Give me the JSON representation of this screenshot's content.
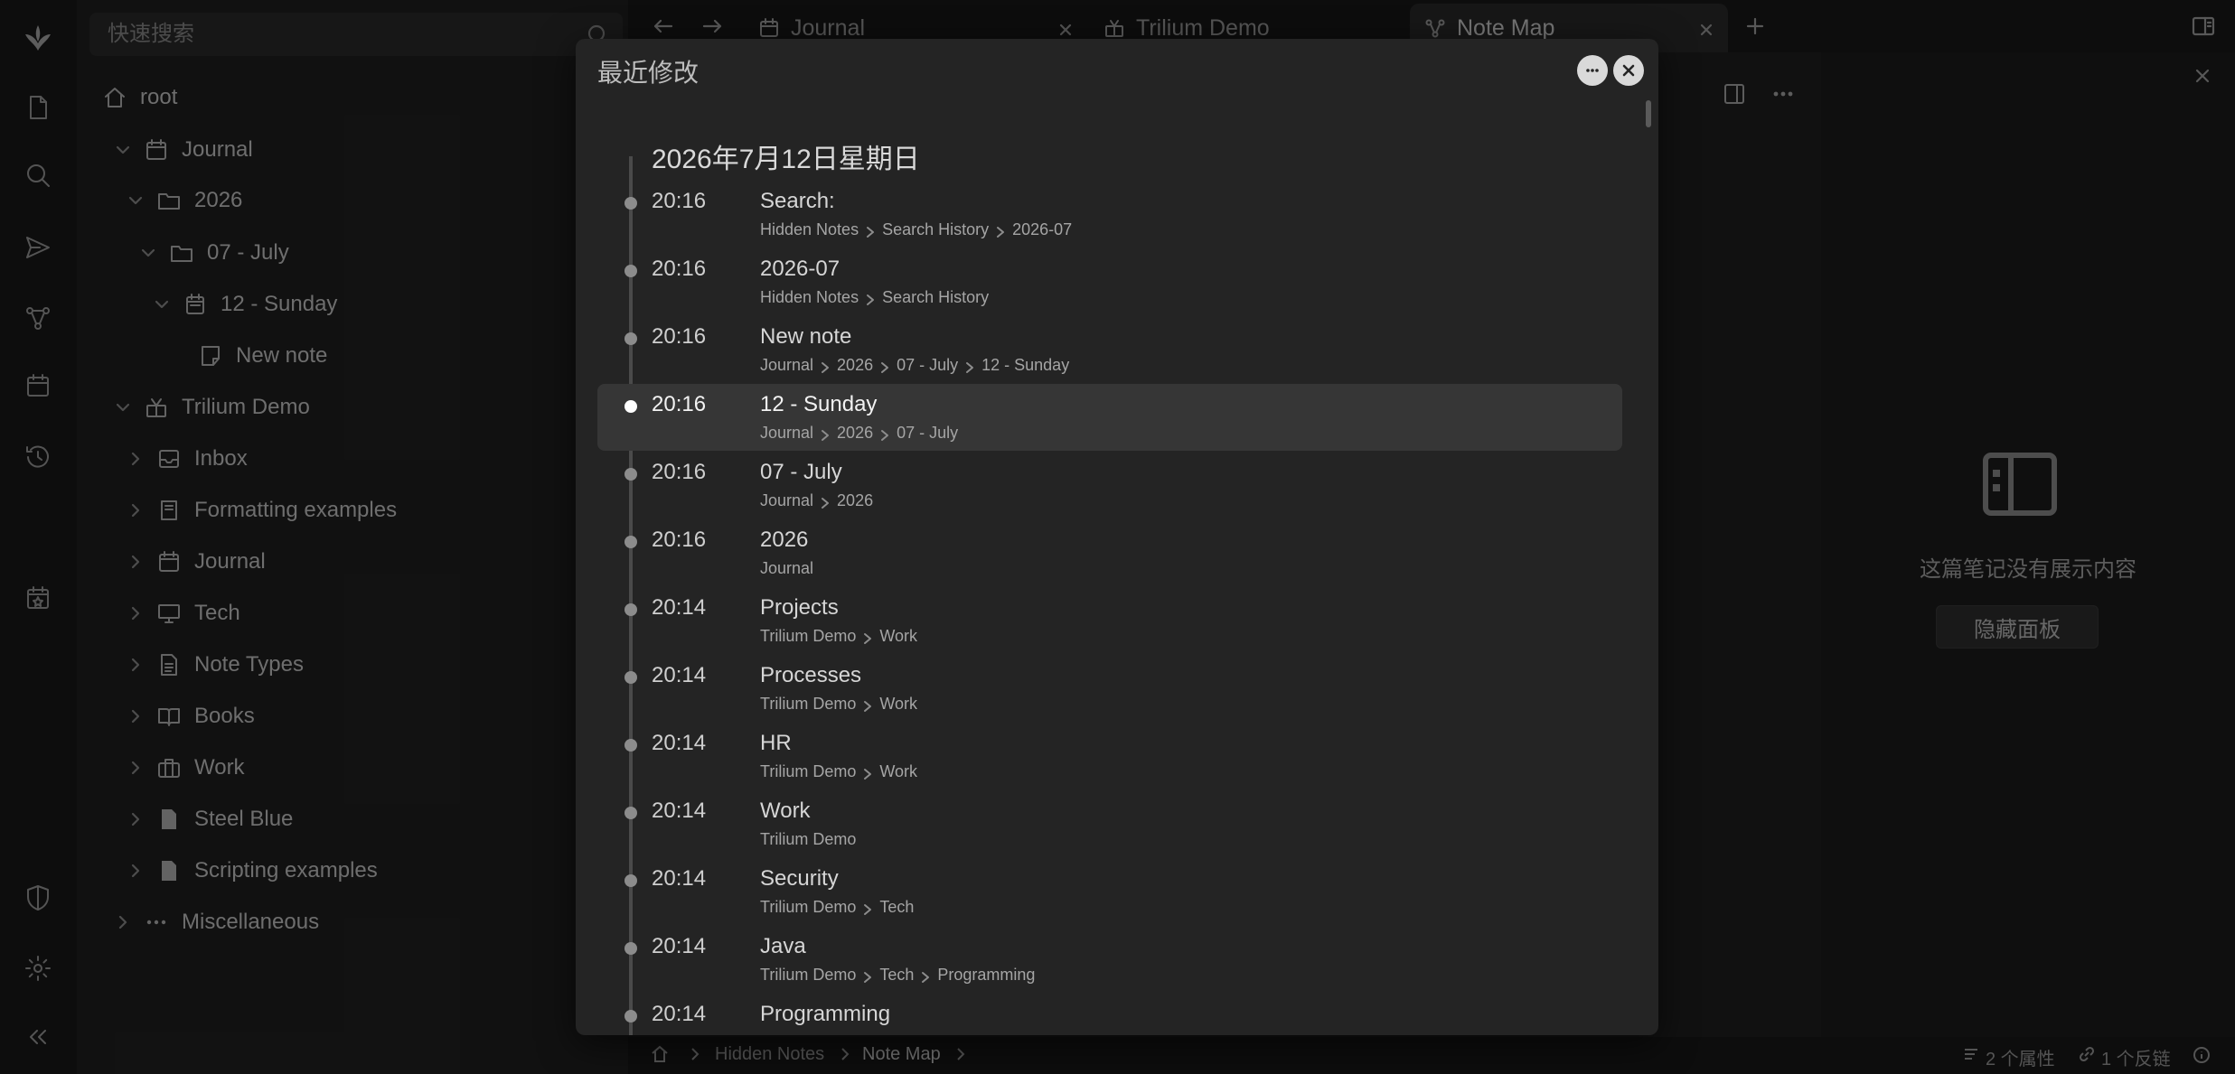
{
  "search": {
    "placeholder": "快速搜索"
  },
  "tree": {
    "items": [
      {
        "label": "root",
        "icon": "home-icon"
      },
      {
        "label": "Journal",
        "icon": "calendar-icon"
      },
      {
        "label": "2026",
        "icon": "folder-icon"
      },
      {
        "label": "07 - July",
        "icon": "folder-icon"
      },
      {
        "label": "12 - Sunday",
        "icon": "calendar-day-icon"
      },
      {
        "label": "New note",
        "icon": "note-icon"
      },
      {
        "label": "Trilium Demo",
        "icon": "demo-icon"
      },
      {
        "label": "Inbox",
        "icon": "inbox-icon"
      },
      {
        "label": "Formatting examples",
        "icon": "book-icon"
      },
      {
        "label": "Journal",
        "icon": "calendar-icon"
      },
      {
        "label": "Tech",
        "icon": "monitor-icon"
      },
      {
        "label": "Note Types",
        "icon": "document-icon"
      },
      {
        "label": "Books",
        "icon": "open-book-icon"
      },
      {
        "label": "Work",
        "icon": "briefcase-icon"
      },
      {
        "label": "Steel Blue",
        "icon": "css-file-icon"
      },
      {
        "label": "Scripting examples",
        "icon": "js-file-icon"
      },
      {
        "label": "Miscellaneous",
        "icon": "dots-icon"
      }
    ]
  },
  "tabs": [
    {
      "label": "Journal",
      "icon": "calendar-icon"
    },
    {
      "label": "Trilium Demo",
      "icon": "demo-icon"
    },
    {
      "label": "Note Map",
      "icon": "map-icon",
      "active": true
    }
  ],
  "right_panel": {
    "empty_text": "这篇笔记没有展示内容",
    "hide_button": "隐藏面板"
  },
  "status": {
    "breadcrumb": [
      "Hidden Notes",
      "Note Map"
    ],
    "attributes": "2 个属性",
    "backlinks": "1 个反链"
  },
  "modal": {
    "title": "最近修改",
    "date": "2026年7月12日星期日",
    "entries": [
      {
        "time": "20:16",
        "title": "Search:",
        "path": [
          "Hidden Notes",
          "Search History",
          "2026-07"
        ]
      },
      {
        "time": "20:16",
        "title": "2026-07",
        "path": [
          "Hidden Notes",
          "Search History"
        ]
      },
      {
        "time": "20:16",
        "title": "New note",
        "path": [
          "Journal",
          "2026",
          "07 - July",
          "12 - Sunday"
        ]
      },
      {
        "time": "20:16",
        "title": "12 - Sunday",
        "path": [
          "Journal",
          "2026",
          "07 - July"
        ],
        "selected": true
      },
      {
        "time": "20:16",
        "title": "07 - July",
        "path": [
          "Journal",
          "2026"
        ]
      },
      {
        "time": "20:16",
        "title": "2026",
        "path": [
          "Journal"
        ]
      },
      {
        "time": "20:14",
        "title": "Projects",
        "path": [
          "Trilium Demo",
          "Work"
        ]
      },
      {
        "time": "20:14",
        "title": "Processes",
        "path": [
          "Trilium Demo",
          "Work"
        ]
      },
      {
        "time": "20:14",
        "title": "HR",
        "path": [
          "Trilium Demo",
          "Work"
        ]
      },
      {
        "time": "20:14",
        "title": "Work",
        "path": [
          "Trilium Demo"
        ]
      },
      {
        "time": "20:14",
        "title": "Security",
        "path": [
          "Trilium Demo",
          "Tech"
        ]
      },
      {
        "time": "20:14",
        "title": "Java",
        "path": [
          "Trilium Demo",
          "Tech",
          "Programming"
        ]
      },
      {
        "time": "20:14",
        "title": "Programming",
        "path": []
      }
    ]
  }
}
